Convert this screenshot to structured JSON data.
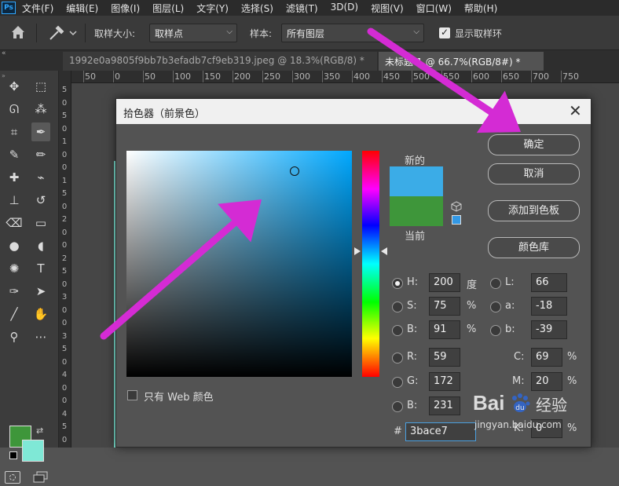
{
  "menubar": {
    "logo": "Ps",
    "items": [
      "文件(F)",
      "编辑(E)",
      "图像(I)",
      "图层(L)",
      "文字(Y)",
      "选择(S)",
      "滤镜(T)",
      "3D(D)",
      "视图(V)",
      "窗口(W)",
      "帮助(H)"
    ]
  },
  "options": {
    "sample_size_label": "取样大小:",
    "sample_size_value": "取样点",
    "sample_label": "样本:",
    "sample_value": "所有图层",
    "show_ring_label": "显示取样环",
    "show_ring_checked": true
  },
  "tabs": [
    {
      "label": "1992e0a9805f9bb7b3efadb7cf9eb319.jpeg @ 18.3%(RGB/8) *",
      "active": false
    },
    {
      "label": "未标题-1 @ 66.7%(RGB/8#) *",
      "active": true
    }
  ],
  "ruler": {
    "top": [
      "50",
      "0",
      "50",
      "100",
      "150",
      "200",
      "250",
      "300",
      "350",
      "400",
      "450",
      "500",
      "550",
      "600",
      "650",
      "700",
      "750"
    ],
    "left": [
      "5",
      "0",
      "5",
      "0",
      "1",
      "0",
      "0",
      "1",
      "5",
      "0",
      "2",
      "0",
      "0",
      "2",
      "5",
      "0",
      "3",
      "0",
      "0",
      "3",
      "5",
      "0",
      "4",
      "0",
      "0",
      "4",
      "5",
      "0"
    ]
  },
  "colors": {
    "foreground": "#3e963a",
    "background": "#7fe8d6",
    "accent": "#d42bd4",
    "new_color": "#3bace7",
    "current_color": "#3e963a"
  },
  "dialog": {
    "title": "拾色器（前景色）",
    "new_label": "新的",
    "current_label": "当前",
    "buttons": {
      "ok": "确定",
      "cancel": "取消",
      "add_swatch": "添加到色板",
      "libraries": "颜色库"
    },
    "web_only_label": "只有 Web 颜色",
    "hsb": {
      "h": {
        "label": "H:",
        "value": "200",
        "unit": "度"
      },
      "s": {
        "label": "S:",
        "value": "75",
        "unit": "%"
      },
      "b": {
        "label": "B:",
        "value": "91",
        "unit": "%"
      }
    },
    "lab": {
      "l": {
        "label": "L:",
        "value": "66"
      },
      "a": {
        "label": "a:",
        "value": "-18"
      },
      "b": {
        "label": "b:",
        "value": "-39"
      }
    },
    "rgb": {
      "r": {
        "label": "R:",
        "value": "59"
      },
      "g": {
        "label": "G:",
        "value": "172"
      },
      "b": {
        "label": "B:",
        "value": "231"
      }
    },
    "cmyk": {
      "c": {
        "label": "C:",
        "value": "69",
        "unit": "%"
      },
      "m": {
        "label": "M:",
        "value": "20",
        "unit": "%"
      },
      "k": {
        "label": "K:",
        "value": "0",
        "unit": "%"
      }
    },
    "hex": {
      "label": "#",
      "value": "3bace7"
    }
  },
  "watermark": {
    "brand": "Bai",
    "brand_cn": "经验",
    "url": "jingyan.baidu.com"
  }
}
